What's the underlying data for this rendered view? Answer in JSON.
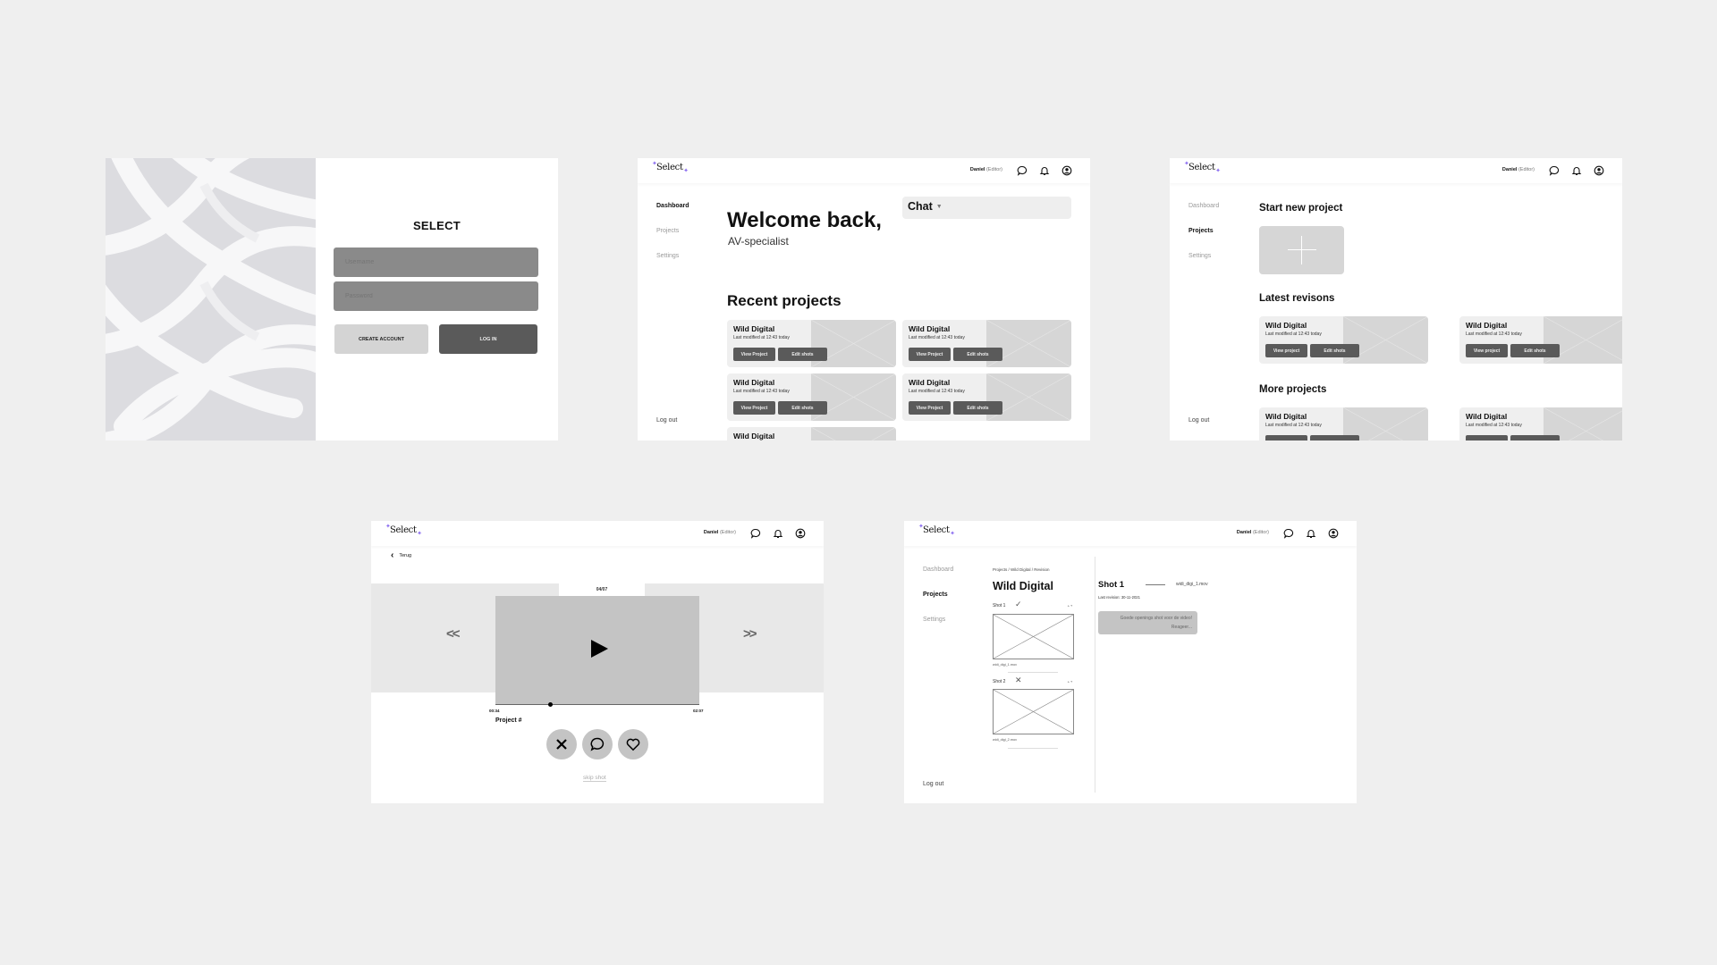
{
  "colors": {
    "canvas": "#efefef",
    "accent": "#8a6cf0",
    "button_dark": "#5a5a5a",
    "input": "#8a8a8a",
    "placeholder": "#d6d6d6"
  },
  "app": {
    "logo": "Select",
    "user_name": "Daniel",
    "user_role": "(Editor)",
    "header_icons": [
      "chat-bubble-icon",
      "bell-icon",
      "user-circle-icon"
    ],
    "nav": {
      "dashboard": "Dashboard",
      "projects": "Projects",
      "settings": "Settings",
      "logout": "Log out"
    }
  },
  "login": {
    "title": "SELECT",
    "username_placeholder": "Username",
    "password_placeholder": "Password",
    "create_account": "CREATE ACCOUNT",
    "log_in": "LOG IN"
  },
  "dashboard": {
    "active_nav": "Dashboard",
    "welcome": "Welcome back,",
    "role": "AV-specialist",
    "chat_label": "Chat",
    "recent_heading": "Recent projects",
    "cards": [
      {
        "title": "Wild Digital",
        "subtitle": "Last modified at 12:43 today",
        "view": "View Project",
        "edit": "Edit shots"
      },
      {
        "title": "Wild Digital",
        "subtitle": "Last modified at 12:43 today",
        "view": "View Project",
        "edit": "Edit shots"
      },
      {
        "title": "Wild Digital",
        "subtitle": "Last modified at 12:43 today",
        "view": "View Project",
        "edit": "Edit shots"
      },
      {
        "title": "Wild Digital",
        "subtitle": "Last modified at 12:43 today",
        "view": "View Project",
        "edit": "Edit shots"
      },
      {
        "title": "Wild Digital"
      }
    ]
  },
  "projects_page": {
    "active_nav": "Projects",
    "new_heading": "Start new project",
    "revisions_heading": "Latest revisons",
    "more_heading": "More projects",
    "revision_cards": [
      {
        "title": "Wild Digital",
        "subtitle": "Last modified at 12:43 today",
        "view": "View project",
        "edit": "Edit shots"
      },
      {
        "title": "Wild Digital",
        "subtitle": "Last modified at 12:43 today",
        "view": "View project",
        "edit": "Edit shots"
      }
    ],
    "more_cards": [
      {
        "title": "Wild Digital",
        "subtitle": "Last modified at 12:43 today"
      },
      {
        "title": "Wild Digital",
        "subtitle": "Last modified at 12:43 today"
      }
    ]
  },
  "player": {
    "back_label": "Terug",
    "counter": "04/07",
    "prev": "<<",
    "next": ">>",
    "time_current": "00:34",
    "time_total": "02:07",
    "progress_fraction": 0.27,
    "project_label": "Project #",
    "actions": [
      "reject",
      "comment",
      "like"
    ],
    "skip_label": "skip shot"
  },
  "shots": {
    "active_nav": "Projects",
    "breadcrumb": "Projects / Wild Digital / Revision",
    "title": "Wild Digital",
    "list": [
      {
        "label": "Shot 1",
        "status": "approved",
        "file": "widi_digi_1.mov"
      },
      {
        "label": "Shot 2",
        "status": "rejected",
        "file": "widi_digi_2.mov"
      }
    ],
    "detail": {
      "title": "Shot 1",
      "file": "widi_digi_1.mov",
      "last_revision": "Last revision: 30-11-2021",
      "comment": "Goede openings shot voor de video!",
      "reply": "Reageer..."
    }
  }
}
